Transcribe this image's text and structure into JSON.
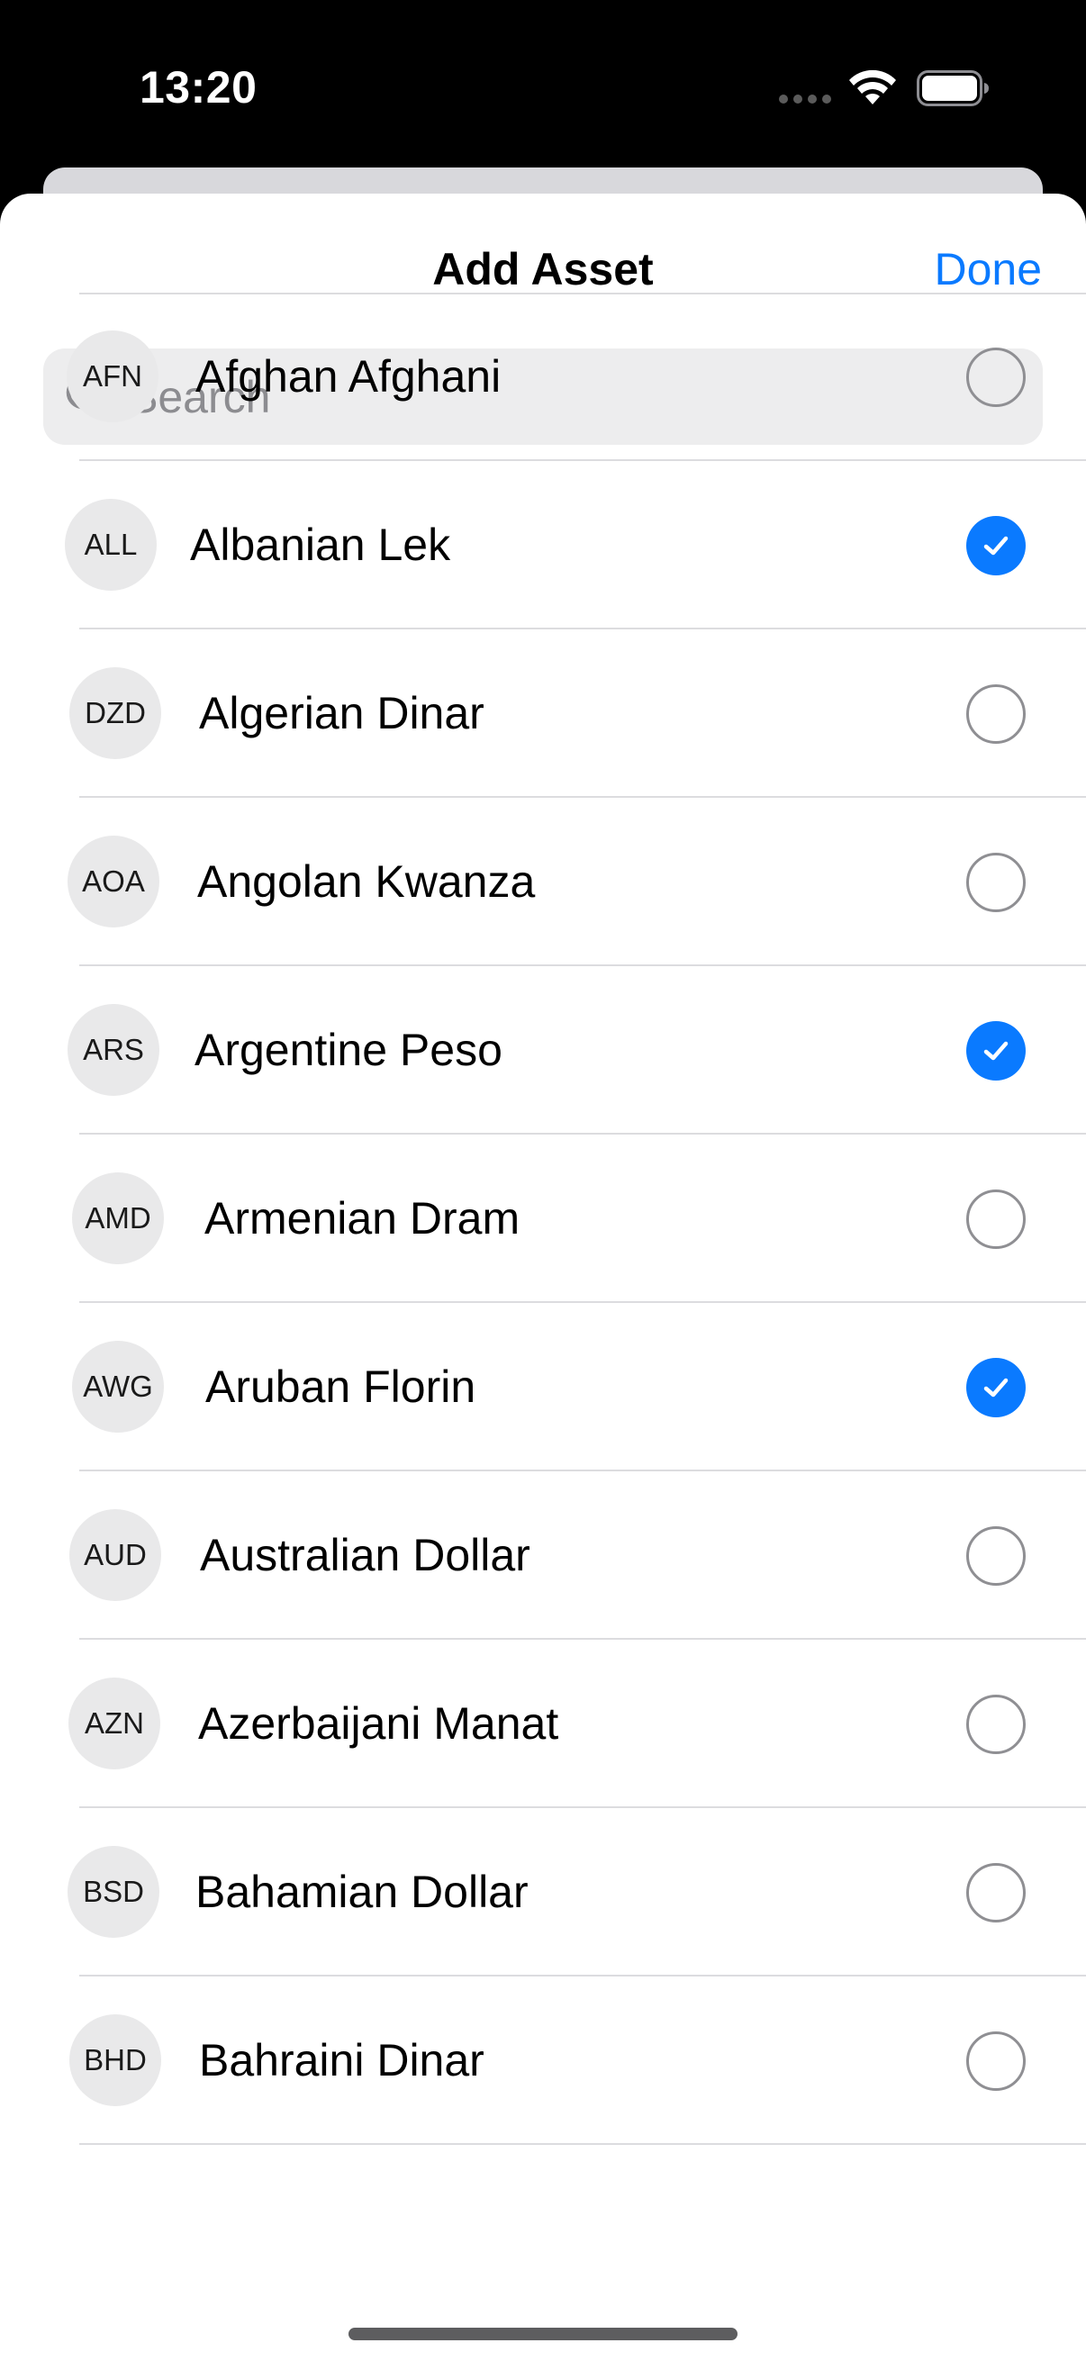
{
  "status_bar": {
    "time": "13:20"
  },
  "sheet": {
    "title": "Add Asset",
    "done_label": "Done"
  },
  "search": {
    "placeholder": "Search",
    "value": ""
  },
  "colors": {
    "accent": "#0a7aff",
    "badge_bg": "#e9e9ea",
    "radio_off": "#8f8f93"
  },
  "assets": [
    {
      "code": "AFN",
      "name": "Afghan Afghani",
      "selected": false
    },
    {
      "code": "ALL",
      "name": "Albanian Lek",
      "selected": true
    },
    {
      "code": "DZD",
      "name": "Algerian Dinar",
      "selected": false
    },
    {
      "code": "AOA",
      "name": "Angolan Kwanza",
      "selected": false
    },
    {
      "code": "ARS",
      "name": "Argentine Peso",
      "selected": true
    },
    {
      "code": "AMD",
      "name": "Armenian Dram",
      "selected": false
    },
    {
      "code": "AWG",
      "name": "Aruban Florin",
      "selected": true
    },
    {
      "code": "AUD",
      "name": "Australian Dollar",
      "selected": false
    },
    {
      "code": "AZN",
      "name": "Azerbaijani Manat",
      "selected": false
    },
    {
      "code": "BSD",
      "name": "Bahamian Dollar",
      "selected": false
    },
    {
      "code": "BHD",
      "name": "Bahraini Dinar",
      "selected": false
    }
  ]
}
